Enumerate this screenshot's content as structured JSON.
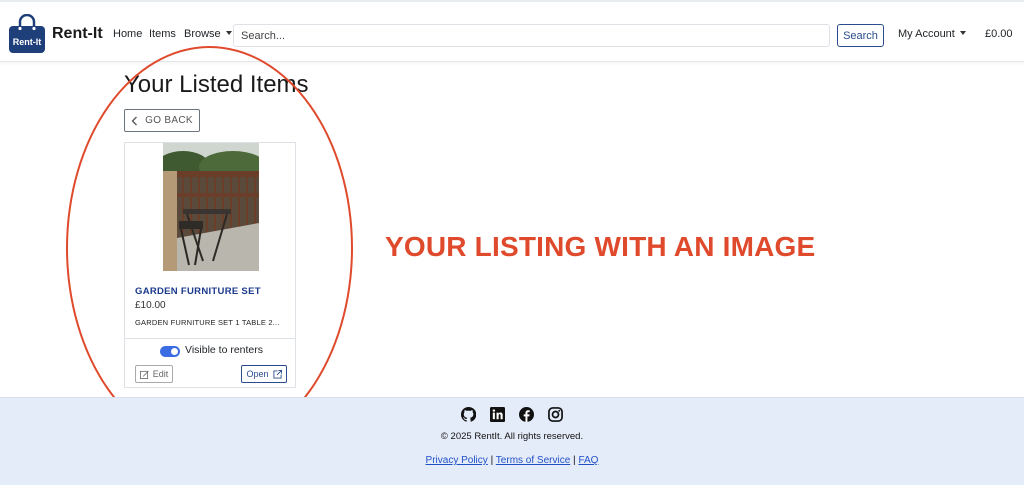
{
  "brand": {
    "name": "Rent-It",
    "logo_text": "Rent-It"
  },
  "nav": {
    "home": "Home",
    "items": "Items",
    "browse": "Browse",
    "search_placeholder": "Search...",
    "search_button": "Search",
    "account": "My Account",
    "cart_total": "£0.00"
  },
  "page": {
    "title": "Your Listed Items",
    "back_label": "GO BACK"
  },
  "listing": {
    "title": "GARDEN FURNITURE SET",
    "price": "£10.00",
    "description": "GARDEN FURNITURE SET 1 TABLE 2...",
    "visibility_label": "Visible to renters",
    "visible": true,
    "edit_label": "Edit",
    "open_label": "Open"
  },
  "annotation": {
    "text": "YOUR LISTING WITH AN IMAGE",
    "color": "#e04a2c"
  },
  "footer": {
    "copyright": "© 2025 RentIt. All rights reserved.",
    "links": [
      "Privacy Policy",
      "Terms of Service",
      "FAQ"
    ],
    "social_icons": [
      "github-icon",
      "linkedin-icon",
      "facebook-icon",
      "instagram-icon"
    ]
  },
  "colors": {
    "primary": "#2b4c8c",
    "toggle": "#3b6ce3",
    "footer_bg": "#e5ecf9"
  }
}
